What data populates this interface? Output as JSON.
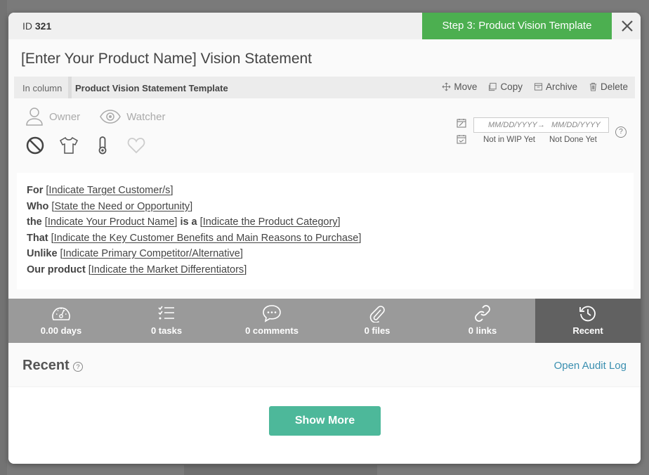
{
  "card": {
    "id_prefix": "ID",
    "id_value": "321",
    "step_badge": "Step 3: Product Vision Template",
    "title": "[Enter Your Product Name] Vision Statement",
    "in_column_label": "In column",
    "column_name": "Product Vision Statement Template",
    "actions": {
      "move": "Move",
      "copy": "Copy",
      "archive": "Archive",
      "delete": "Delete"
    },
    "people": {
      "owner": "Owner",
      "watcher": "Watcher"
    },
    "dates": {
      "start_placeholder": "MM/DD/YYYY",
      "arrow": "→",
      "end_placeholder": "MM/DD/YYYY",
      "start_status": "Not in WIP Yet",
      "end_status": "Not Done Yet"
    },
    "description": [
      {
        "bold": "For",
        "parts": [
          "Indicate Target Customer/s"
        ]
      },
      {
        "bold": "Who",
        "parts": [
          "State the Need or Opportunity"
        ]
      },
      {
        "bold": "the",
        "parts": [
          "Indicate Your Product Name"
        ],
        "mid_bold": "is a",
        "parts2": [
          "Indicate the Product Category"
        ]
      },
      {
        "bold": "That",
        "parts": [
          "Indicate the Key Customer Benefits and Main Reasons to Purchase"
        ]
      },
      {
        "bold": "Unlike",
        "parts": [
          "Indicate Primary Competitor/Alternative"
        ]
      },
      {
        "bold": "Our product",
        "parts": [
          "Indicate the Market Differentiators"
        ]
      }
    ]
  },
  "tabs": [
    {
      "label": "0.00 days",
      "icon": "gauge-icon"
    },
    {
      "label": "0 tasks",
      "icon": "checklist-icon"
    },
    {
      "label": "0 comments",
      "icon": "comment-icon"
    },
    {
      "label": "0 files",
      "icon": "paperclip-icon"
    },
    {
      "label": "0 links",
      "icon": "link-icon"
    },
    {
      "label": "Recent",
      "icon": "history-icon",
      "active": true
    }
  ],
  "recent": {
    "title": "Recent",
    "help": "?",
    "audit_link": "Open Audit Log",
    "show_more": "Show More"
  },
  "colors": {
    "step_badge": "#4caf50",
    "active_tab": "#616161",
    "tab_bar": "#9a9a9a",
    "show_more": "#4db89a",
    "link": "#3a8fb0"
  }
}
